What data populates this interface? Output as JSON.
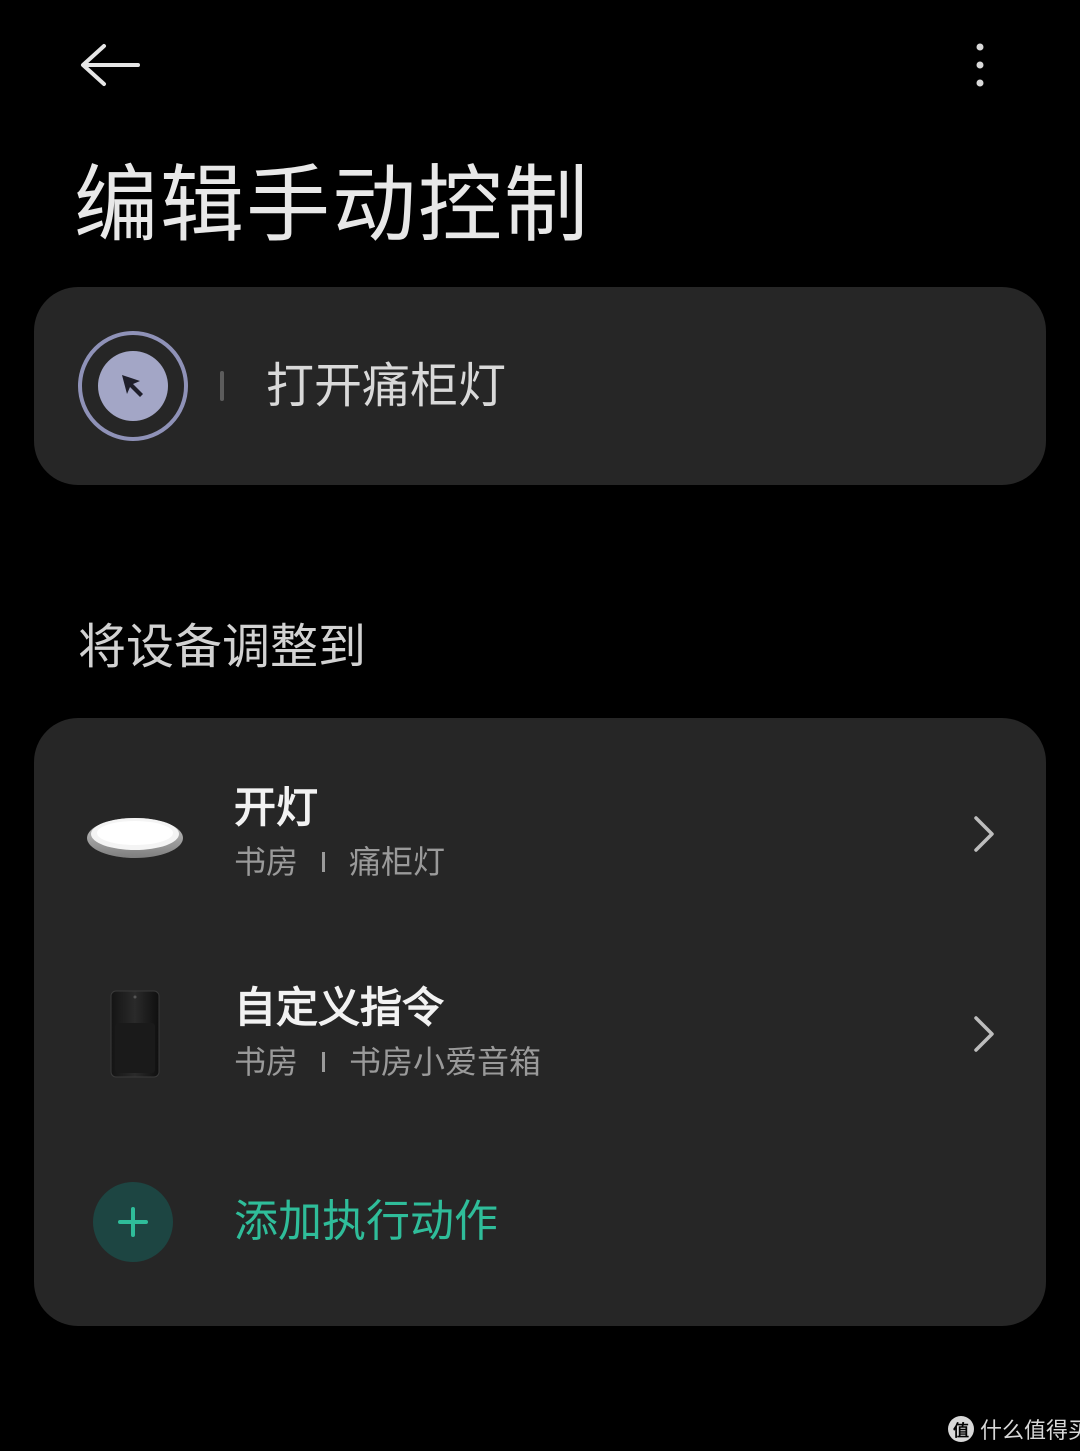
{
  "header": {
    "back_icon": "arrow-left-icon",
    "more_icon": "more-vertical-icon",
    "title": "编辑手动控制"
  },
  "scene": {
    "icon": "cursor-pointer-icon",
    "icon_color": "#a3a6c6",
    "name": "打开痛柜灯"
  },
  "actions_section": {
    "heading": "将设备调整到",
    "items": [
      {
        "device_icon": "ceiling-light-icon",
        "title": "开灯",
        "room": "书房",
        "device": "痛柜灯"
      },
      {
        "device_icon": "smart-speaker-icon",
        "title": "自定义指令",
        "room": "书房",
        "device": "书房小爱音箱"
      }
    ],
    "add_label": "添加执行动作",
    "add_color": "#2fbd9a"
  },
  "watermark": {
    "badge": "值",
    "text": "什么值得买"
  }
}
